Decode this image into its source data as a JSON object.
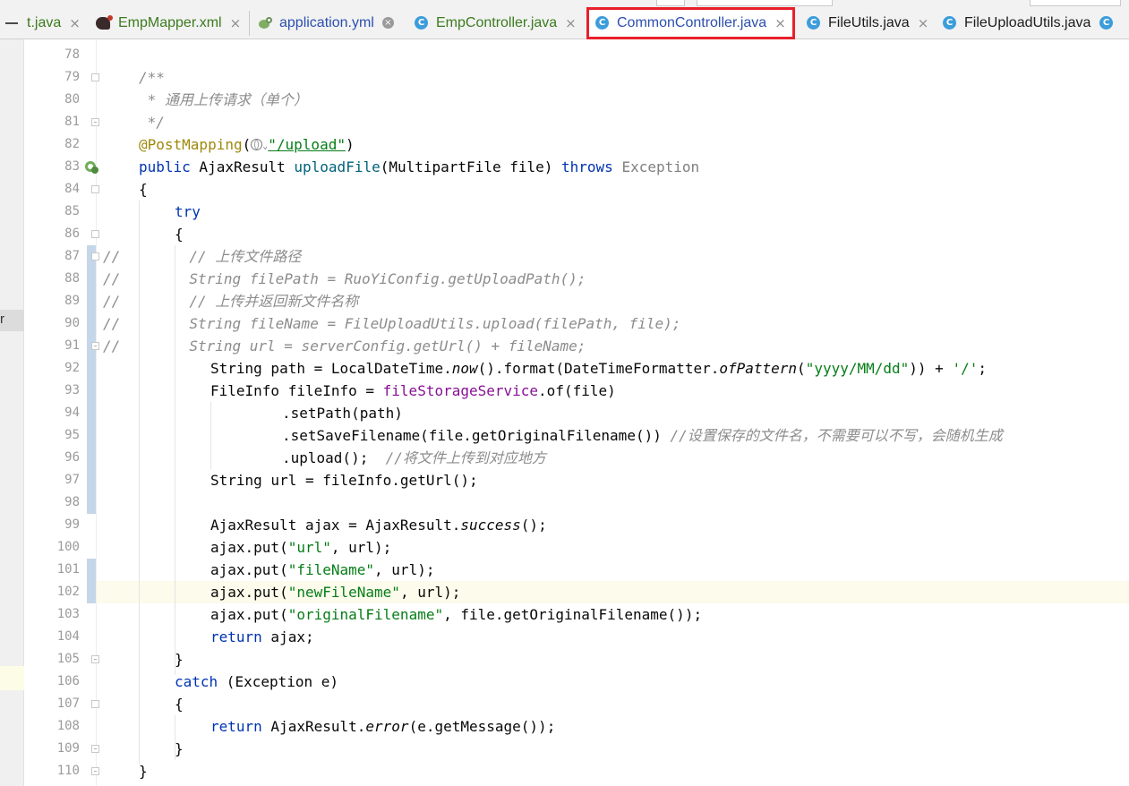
{
  "tabs": [
    {
      "label": "t.java",
      "color": "#3c7b1f",
      "icon": "none",
      "close": "×"
    },
    {
      "label": "EmpMapper.xml",
      "color": "#3c7b1f",
      "icon": "mybatis-bird-icon",
      "close": "×"
    },
    {
      "label": "application.yml",
      "color": "#2c4fae",
      "icon": "spring-yml-icon",
      "close": "×"
    },
    {
      "label": "EmpController.java",
      "color": "#3c7b1f",
      "icon": "class-icon",
      "close": "×"
    },
    {
      "label": "CommonController.java",
      "color": "#2c4fae",
      "icon": "class-icon",
      "close": "×",
      "active": true
    },
    {
      "label": "FileUtils.java",
      "color": "#1c1c1c",
      "icon": "class-icon",
      "close": "×"
    },
    {
      "label": "FileUploadUtils.java",
      "color": "#1c1c1c",
      "icon": "class-icon",
      "close": ""
    }
  ],
  "class_icon_letter": "C",
  "left_strip": {
    "label": "r"
  },
  "colors": {
    "keyword": "#0033b3",
    "comment": "#8c8c8c",
    "string": "#067d17",
    "annotation": "#9e880d",
    "field": "#871094",
    "highlight_box": "#e8202b",
    "current_line": "#fcfbec"
  },
  "line_numbers": [
    "78",
    "79",
    "80",
    "81",
    "82",
    "83",
    "84",
    "85",
    "86",
    "87",
    "88",
    "89",
    "90",
    "91",
    "92",
    "93",
    "94",
    "95",
    "96",
    "97",
    "98",
    "99",
    "100",
    "101",
    "102",
    "103",
    "104",
    "105",
    "106",
    "107",
    "108",
    "109",
    "110"
  ],
  "current_line": "102",
  "code": {
    "l79": "/**",
    "l80": " * 通用上传请求（单个）",
    "l81": " */",
    "l82": {
      "annotation": "@PostMapping",
      "open": "(",
      "path": "\"/upload\"",
      "close": ")"
    },
    "l83": {
      "kw1": "public",
      "type": " AjaxResult ",
      "method": "uploadFile",
      "params": "(MultipartFile file) ",
      "kw2": "throws",
      "exc": " Exception"
    },
    "l84": "{",
    "l85": "try",
    "l86": "{",
    "l87": {
      "prefix": "//",
      "text": "        // 上传文件路径"
    },
    "l88": {
      "prefix": "//",
      "text": "        String filePath = RuoYiConfig.getUploadPath();"
    },
    "l89": {
      "prefix": "//",
      "text": "        // 上传并返回新文件名称"
    },
    "l90": {
      "prefix": "//",
      "text": "        String fileName = FileUploadUtils.upload(filePath, file);"
    },
    "l91": {
      "prefix": "//",
      "text": "        String url = serverConfig.getUrl() + fileName;"
    },
    "l92": {
      "a": "String path = LocalDateTime.",
      "b": "now",
      "c": "().format(DateTimeFormatter.",
      "d": "ofPattern",
      "e": "(",
      "f": "\"yyyy/MM/dd\"",
      "g": ")) + ",
      "h": "'/'",
      "i": ";"
    },
    "l93": {
      "a": "FileInfo fileInfo = ",
      "b": "fileStorageService",
      "c": ".of(file)"
    },
    "l94": ".setPath(path)",
    "l95": {
      "code": ".setSaveFilename(file.getOriginalFilename()) ",
      "comment": "//设置保存的文件名，不需要可以不写，会随机生成"
    },
    "l96": {
      "code": ".upload();  ",
      "comment": "//将文件上传到对应地方"
    },
    "l97": "String url = fileInfo.getUrl();",
    "l99": {
      "a": "AjaxResult ajax = AjaxResult.",
      "b": "success",
      "c": "();"
    },
    "l100": {
      "a": "ajax.put(",
      "s": "\"url\"",
      "b": ", url);"
    },
    "l101": {
      "a": "ajax.put(",
      "s": "\"fileName\"",
      "b": ", url);"
    },
    "l102": {
      "a": "ajax.put(",
      "s": "\"newFileName\"",
      "b": ", url);"
    },
    "l103": {
      "a": "ajax.put(",
      "s": "\"originalFilename\"",
      "b": ", file.getOriginalFilename());"
    },
    "l104": {
      "kw": "return",
      "b": " ajax;"
    },
    "l105": "}",
    "l106": {
      "kw": "catch",
      "b": " (Exception e)"
    },
    "l107": "{",
    "l108": {
      "kw": "return",
      "a": " AjaxResult.",
      "m": "error",
      "b": "(e.getMessage());"
    },
    "l109": "}",
    "l110": "}"
  }
}
